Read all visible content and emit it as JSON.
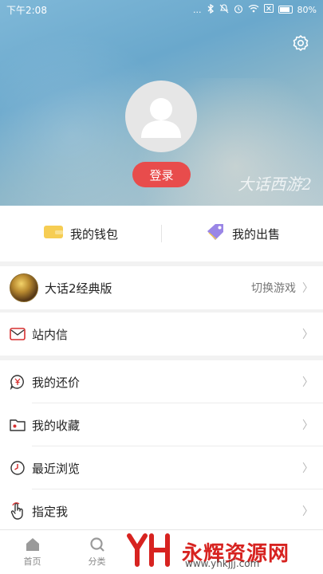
{
  "status_bar": {
    "time": "下午2:08",
    "dots": "...",
    "battery": "80%"
  },
  "header": {
    "login_label": "登录",
    "watermark": "大话西游2"
  },
  "wallet_row": {
    "wallet_label": "我的钱包",
    "sell_label": "我的出售"
  },
  "game_row": {
    "name": "大话2经典版",
    "switch_label": "切换游戏"
  },
  "menu": {
    "messages": "站内信",
    "bargain": "我的还价",
    "favorites": "我的收藏",
    "recent": "最近浏览",
    "designated": "指定我"
  },
  "chevron": "〉",
  "tabbar": {
    "home": "首页",
    "category": "分类"
  },
  "watermark_logo": {
    "text": "永辉资源网",
    "url": "www.yhkjjj.com"
  },
  "colors": {
    "accent": "#e84c4c",
    "wallet_icon": "#f6cd53",
    "sell_icon": "#9a86e6"
  }
}
